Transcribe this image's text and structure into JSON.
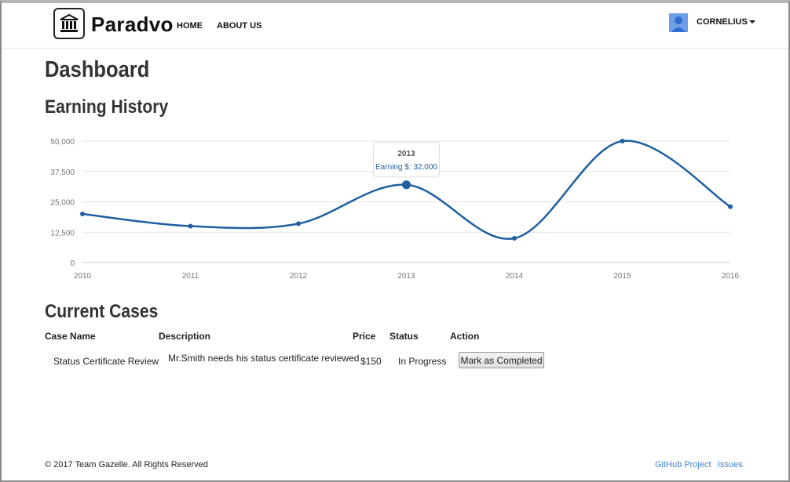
{
  "brand": {
    "name": "Paradvo",
    "logo_icon": "bank-icon"
  },
  "nav": {
    "home": "HOME",
    "about": "ABOUT US",
    "user": "CORNELIUS"
  },
  "page": {
    "title": "Dashboard",
    "earning_title": "Earning History",
    "cases_title": "Current Cases"
  },
  "chart_data": {
    "type": "line",
    "x": [
      "2010",
      "2011",
      "2012",
      "2013",
      "2014",
      "2015",
      "2016"
    ],
    "series": [
      {
        "values": [
          20000,
          15000,
          16000,
          32000,
          10000,
          50000,
          23000
        ],
        "color": "#1f5fa1"
      }
    ],
    "y_ticks": [
      "0",
      "12,500",
      "25,000",
      "37,500",
      "50,000"
    ],
    "ylim": [
      0,
      50000
    ],
    "grid": true,
    "tooltip": {
      "title": "2013",
      "label": "Earning $: 32,000"
    }
  },
  "cases": {
    "headers": {
      "name": "Case Name",
      "description": "Description",
      "price": "Price",
      "status": "Status",
      "action": "Action"
    },
    "rows": [
      {
        "name": "Status Certificate Review",
        "description": "Mr.Smith needs his status certificate reviewed",
        "price": "$150",
        "status": "In Progress",
        "action": "Mark as Completed"
      }
    ]
  },
  "footer": {
    "copyright": "© 2017 Team Gazelle. All Rights Reserved",
    "github": "GitHub Project",
    "issues": "Issues"
  }
}
